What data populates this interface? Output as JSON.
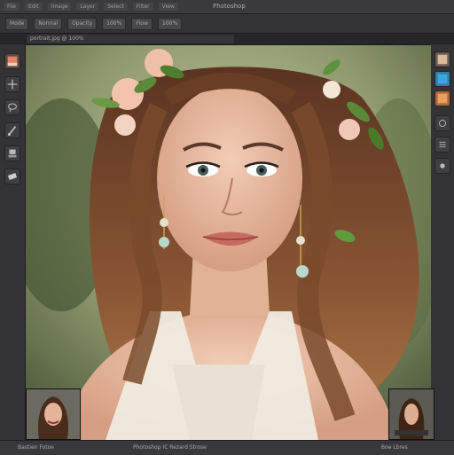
{
  "app": {
    "title": "Photoshop",
    "menus": [
      "File",
      "Edit",
      "Image",
      "Layer",
      "Select",
      "Filter",
      "View"
    ]
  },
  "options_bar": {
    "fields": [
      "Mode",
      "Normal",
      "Opacity",
      "100%",
      "Flow",
      "100%"
    ]
  },
  "document": {
    "tab_label": "portrait.jpg @ 100%"
  },
  "left_tools": [
    "image-thumb-icon",
    "move-icon",
    "lasso-icon",
    "brush-icon",
    "stamp-icon",
    "eraser-icon"
  ],
  "right_tools": [
    "layers-icon",
    "color-swatch-icon",
    "adjustments-icon",
    "history-icon",
    "properties-icon",
    "channels-icon"
  ],
  "status": {
    "left": "Bastien Fotoe",
    "center": "Photoshop  IC  Rezard  Strose",
    "right": "Boe  Lbres"
  },
  "colors": {
    "chrome": "#3a3a3c",
    "panel": "#333335",
    "accent_blue": "#3aa8d8",
    "accent_orange": "#e07a3a"
  }
}
